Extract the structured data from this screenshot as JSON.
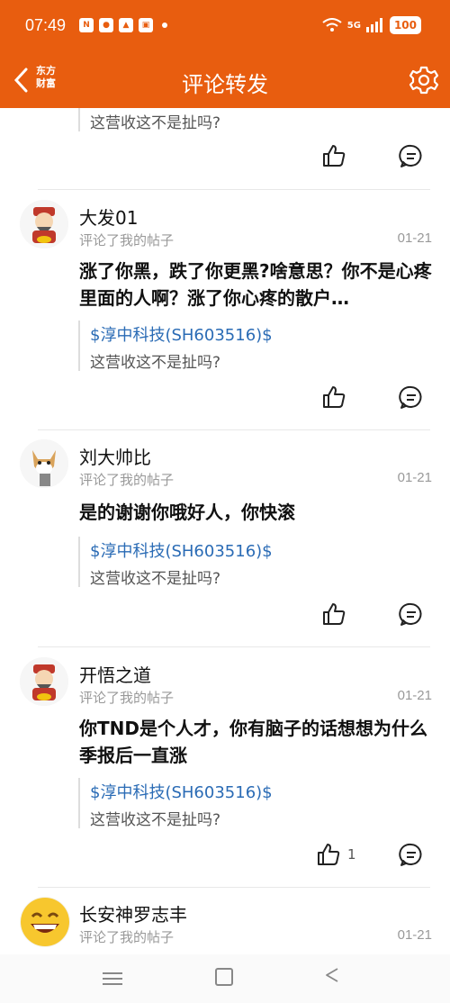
{
  "status_bar": {
    "time": "07:49",
    "network": "5G",
    "battery": "100"
  },
  "header": {
    "title": "评论转发",
    "logo_line1": "东方",
    "logo_line2": "财富"
  },
  "top_quote": {
    "text": "这营收这不是扯吗?"
  },
  "comments": [
    {
      "username": "大发01",
      "action": "评论了我的帖子",
      "date": "01-21",
      "text": "涨了你黑，跌了你更黑?啥意思？你不是心疼里面的人啊？涨了你心疼的散户…",
      "quote_link": "$淳中科技(SH603516)$",
      "quote_text": "这营收这不是扯吗?",
      "likes": ""
    },
    {
      "username": "刘大帅比",
      "action": "评论了我的帖子",
      "date": "01-21",
      "text": "是的谢谢你哦好人，你快滚",
      "quote_link": "$淳中科技(SH603516)$",
      "quote_text": "这营收这不是扯吗?",
      "likes": ""
    },
    {
      "username": "开悟之道",
      "action": "评论了我的帖子",
      "date": "01-21",
      "text": "你TND是个人才，你有脑子的话想想为什么季报后一直涨",
      "quote_link": "$淳中科技(SH603516)$",
      "quote_text": "这营收这不是扯吗?",
      "likes": "1"
    },
    {
      "username": "长安神罗志丰",
      "action": "评论了我的帖子",
      "date": "01-21"
    }
  ],
  "colors": {
    "brand": "#e85d0f",
    "link": "#2a6bb5"
  }
}
